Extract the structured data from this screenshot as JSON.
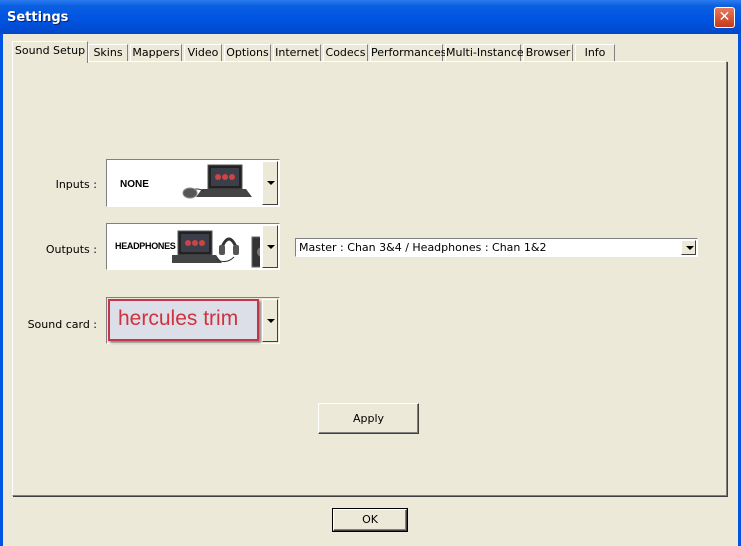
{
  "window": {
    "title": "Settings",
    "close_symbol": "✕"
  },
  "tabs": [
    {
      "label": "Sound Setup",
      "active": true
    },
    {
      "label": "Skins"
    },
    {
      "label": "Mappers"
    },
    {
      "label": "Video"
    },
    {
      "label": "Options"
    },
    {
      "label": "Internet"
    },
    {
      "label": "Codecs"
    },
    {
      "label": "Performances"
    },
    {
      "label": "Multi-Instance"
    },
    {
      "label": "Browser"
    },
    {
      "label": "Info"
    }
  ],
  "sound_setup": {
    "inputs": {
      "label": "Inputs :",
      "value": "NONE"
    },
    "outputs": {
      "label": "Outputs :",
      "value": "HEADPHONES"
    },
    "channel_routing": {
      "value": "Master : Chan 3&4 / Headphones : Chan 1&2"
    },
    "sound_card": {
      "label": "Sound card :",
      "value": "hercules trim"
    },
    "apply_label": "Apply"
  },
  "footer": {
    "ok_label": "OK"
  },
  "colors": {
    "titlebar": "#0054e3",
    "face": "#ece9d8",
    "soundcard_text": "#d0323e"
  }
}
